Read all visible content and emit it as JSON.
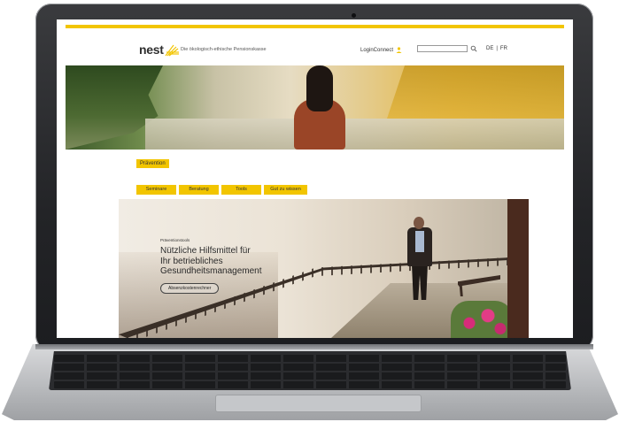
{
  "site": {
    "logo_text": "nest",
    "tagline": "Die ökologisch-ethische Pensionskasse",
    "accent_color": "#f2c500"
  },
  "header": {
    "login_label": "LoginConnect",
    "search_placeholder": "",
    "languages": [
      "DE",
      "|",
      "FR"
    ]
  },
  "section_tag": "Prävention",
  "sub_nav": [
    "Seminare",
    "Beratung",
    "Tools",
    "Gut zu wissen"
  ],
  "promo": {
    "kicker": "Präventionstools",
    "headline_lines": [
      "Nützliche Hilfsmittel für",
      "Ihr betriebliches",
      "Gesundheitsmanagement"
    ],
    "button_label": "Absenzkostenrechner"
  }
}
